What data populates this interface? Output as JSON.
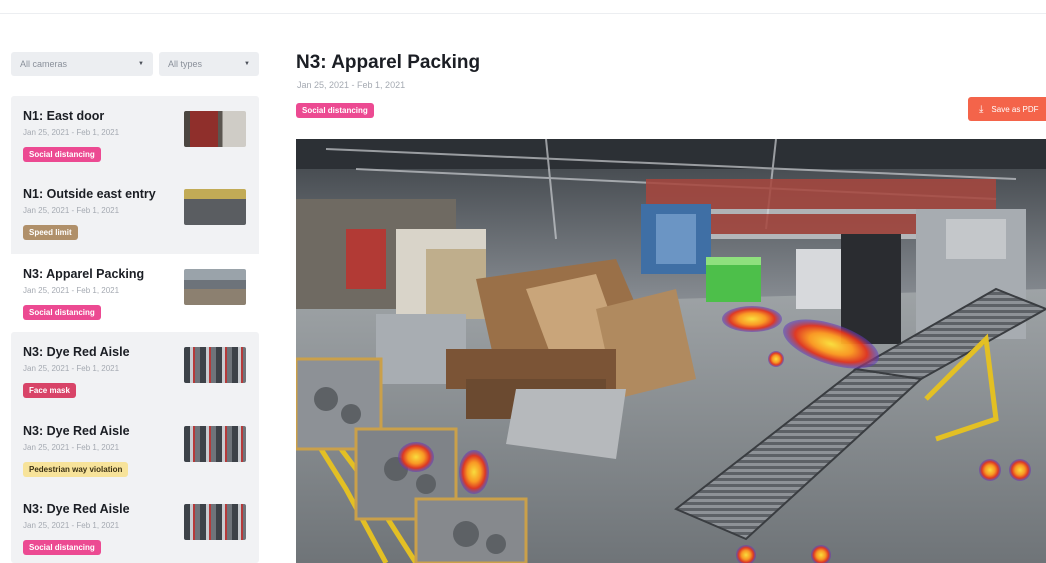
{
  "filters": {
    "cameras": "All cameras",
    "types": "All types"
  },
  "cards": [
    {
      "title": "N1: East door",
      "date": "Jan 25, 2021 - Feb 1, 2021",
      "badge": "Social distancing",
      "thumb": "east-door-camera-thumbnail"
    },
    {
      "title": "N1: Outside east entry",
      "date": "Jan 25, 2021 - Feb 1, 2021",
      "badge": "Speed limit",
      "thumb": "outside-east-entry-camera-thumbnail"
    },
    {
      "title": "N3: Apparel Packing",
      "date": "Jan 25, 2021 - Feb 1, 2021",
      "badge": "Social distancing",
      "thumb": "apparel-packing-camera-thumbnail"
    },
    {
      "title": "N3: Dye Red Aisle",
      "date": "Jan 25, 2021 - Feb 1, 2021",
      "badge": "Face mask",
      "thumb": "dye-red-aisle-camera-thumbnail"
    },
    {
      "title": "N3: Dye Red Aisle",
      "date": "Jan 25, 2021 - Feb 1, 2021",
      "badge": "Pedestrian way violation",
      "thumb": "dye-red-aisle-camera-thumbnail"
    },
    {
      "title": "N3: Dye Red Aisle",
      "date": "Jan 25, 2021 - Feb 1, 2021",
      "badge": "Social distancing",
      "thumb": "dye-red-aisle-camera-thumbnail"
    }
  ],
  "main": {
    "title": "N3: Apparel Packing",
    "date": "Jan 25, 2021 - Feb 1, 2021",
    "badge": "Social distancing",
    "save_label": "Save as PDF",
    "save_icon": "download-icon"
  },
  "colors": {
    "badge_social": "#ec4a92",
    "badge_speed": "#b0906a",
    "badge_mask": "#d84468",
    "badge_pedestrian": "#f7e39a",
    "save_button": "#f4644a",
    "card_group_bg": "#f1f2f4"
  }
}
